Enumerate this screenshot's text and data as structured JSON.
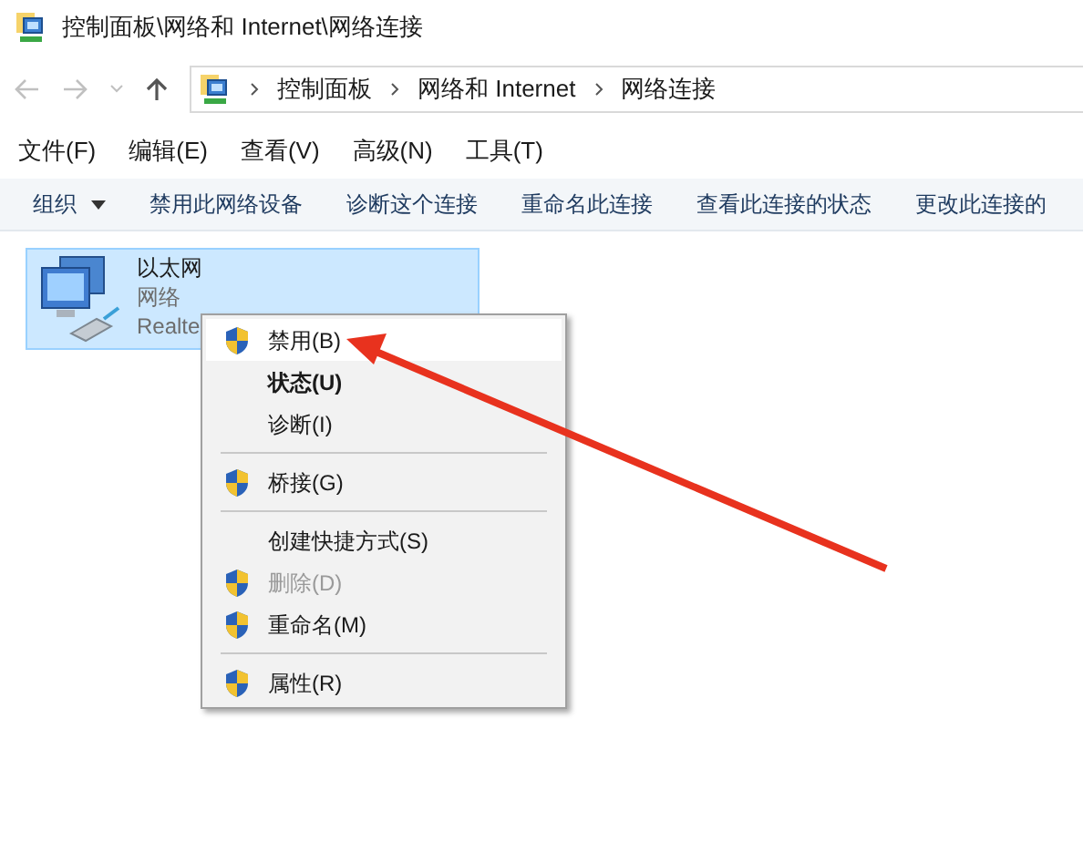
{
  "window": {
    "title": "控制面板\\网络和 Internet\\网络连接"
  },
  "address_bar": {
    "crumbs": [
      "控制面板",
      "网络和 Internet",
      "网络连接"
    ]
  },
  "menu_bar": [
    "文件(F)",
    "编辑(E)",
    "查看(V)",
    "高级(N)",
    "工具(T)"
  ],
  "toolbar": [
    {
      "label": "组织",
      "kind": "dropdown"
    },
    {
      "label": "禁用此网络设备",
      "kind": "button"
    },
    {
      "label": "诊断这个连接",
      "kind": "button"
    },
    {
      "label": "重命名此连接",
      "kind": "button"
    },
    {
      "label": "查看此连接的状态",
      "kind": "button"
    },
    {
      "label": "更改此连接的",
      "kind": "button"
    }
  ],
  "adapter": {
    "name": "以太网",
    "network": "网络",
    "device": "Realte",
    "selected": true
  },
  "context_menu": [
    {
      "kind": "item",
      "label": "禁用(B)",
      "shield": true,
      "bold": false,
      "disabled": false,
      "selected": true
    },
    {
      "kind": "item",
      "label": "状态(U)",
      "shield": false,
      "bold": true,
      "disabled": false,
      "selected": false
    },
    {
      "kind": "item",
      "label": "诊断(I)",
      "shield": false,
      "bold": false,
      "disabled": false,
      "selected": false
    },
    {
      "kind": "separator"
    },
    {
      "kind": "item",
      "label": "桥接(G)",
      "shield": true,
      "bold": false,
      "disabled": false,
      "selected": false
    },
    {
      "kind": "separator"
    },
    {
      "kind": "item",
      "label": "创建快捷方式(S)",
      "shield": false,
      "bold": false,
      "disabled": false,
      "selected": false
    },
    {
      "kind": "item",
      "label": "删除(D)",
      "shield": true,
      "bold": false,
      "disabled": true,
      "selected": false
    },
    {
      "kind": "item",
      "label": "重命名(M)",
      "shield": true,
      "bold": false,
      "disabled": false,
      "selected": false
    },
    {
      "kind": "separator"
    },
    {
      "kind": "item",
      "label": "属性(R)",
      "shield": true,
      "bold": false,
      "disabled": false,
      "selected": false
    }
  ]
}
